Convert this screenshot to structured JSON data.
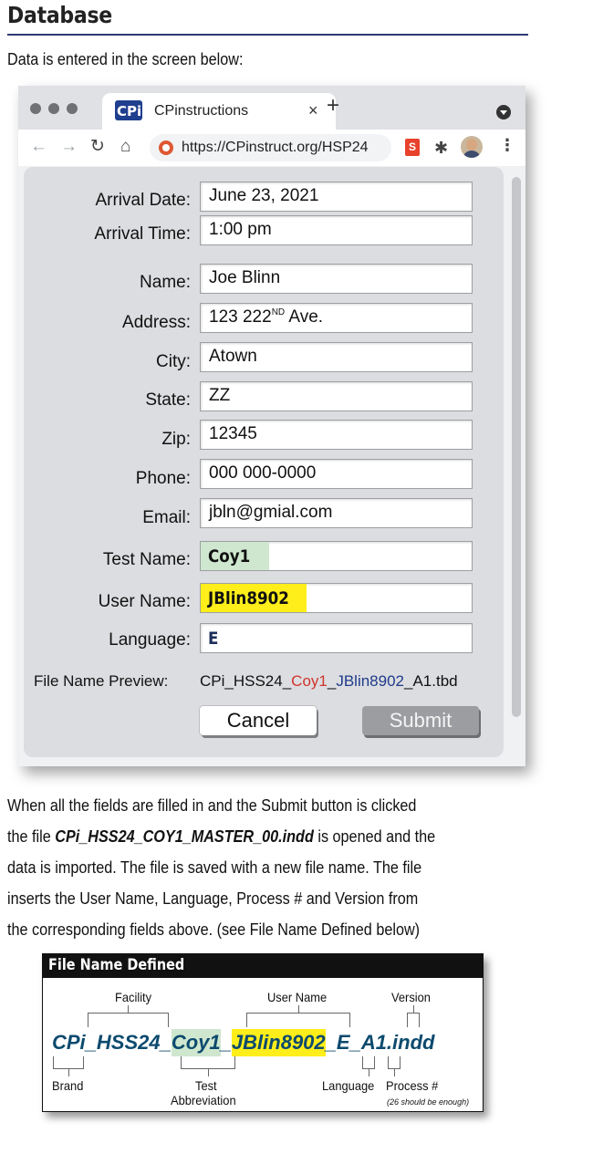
{
  "heading": "Database",
  "intro": "Data is entered in the screen below:",
  "browser": {
    "tab_title": "CPinstructions",
    "tab_close": "×",
    "new_tab": "+",
    "logo_text": "CPi",
    "url": "https://CPinstruct.org/HSP24",
    "ext_label": "S"
  },
  "form": {
    "arrival_date": {
      "label": "Arrival Date:",
      "value": "June 23, 2021"
    },
    "arrival_time": {
      "label": "Arrival Time:",
      "value": "1:00 pm"
    },
    "name": {
      "label": "Name:",
      "value": "Joe Blinn"
    },
    "address": {
      "label": "Address:",
      "value": "123 222",
      "value_sup": "ND",
      "value_suffix": " Ave."
    },
    "city": {
      "label": "City:",
      "value": "Atown"
    },
    "state": {
      "label": "State:",
      "value": "ZZ"
    },
    "zip": {
      "label": "Zip:",
      "value": "12345"
    },
    "phone": {
      "label": "Phone:",
      "value": "000 000-0000"
    },
    "email": {
      "label": "Email:",
      "value": "jbln@gmial.com"
    },
    "test_name": {
      "label": "Test Name:",
      "value": "Coy1"
    },
    "user_name": {
      "label": "User Name:",
      "value": "JBlin8902"
    },
    "language": {
      "label": "Language:",
      "value": "E"
    },
    "preview": {
      "label": "File Name Preview:",
      "prefix": "CPi_HSS24_",
      "test": "Coy1",
      "sep": "_",
      "user": "JBlin8902",
      "suffix": "_A1.tbd"
    },
    "cancel_label": "Cancel",
    "submit_label": "Submit",
    "colors": {
      "test_highlight": "#cfe7cf",
      "user_highlight": "#ffee1a",
      "preview_red": "#d0342c",
      "preview_blue": "#1e3a8a"
    }
  },
  "paragraph": {
    "line1": "When all the fields are filled in and the Submit button is clicked",
    "line2_pre": "the file ",
    "line2_file": "CPi_HSS24_COY1_MASTER_00.indd",
    "line2_post": " is opened and the",
    "line3": "data is imported. The file is saved with a new file name. The file",
    "line4": "inserts the User Name, Language, Process # and Version from",
    "line5": "the corresponding fields above. (see File Name Defined below)"
  },
  "diagram": {
    "title": "File Name Defined",
    "segments": {
      "s1": "CPi",
      "s2": "_HSS24_",
      "s3": "Coy1",
      "s4": "_",
      "s5": "JBlin8902",
      "s6": "_E_",
      "s7": "A1.indd"
    },
    "labels": {
      "facility": "Facility",
      "user_name": "User Name",
      "version": "Version",
      "brand": "Brand",
      "test_line1": "Test",
      "test_line2": "Abbreviation",
      "language": "Language",
      "process": "Process #",
      "process_note": "(26 should be enough)"
    }
  }
}
